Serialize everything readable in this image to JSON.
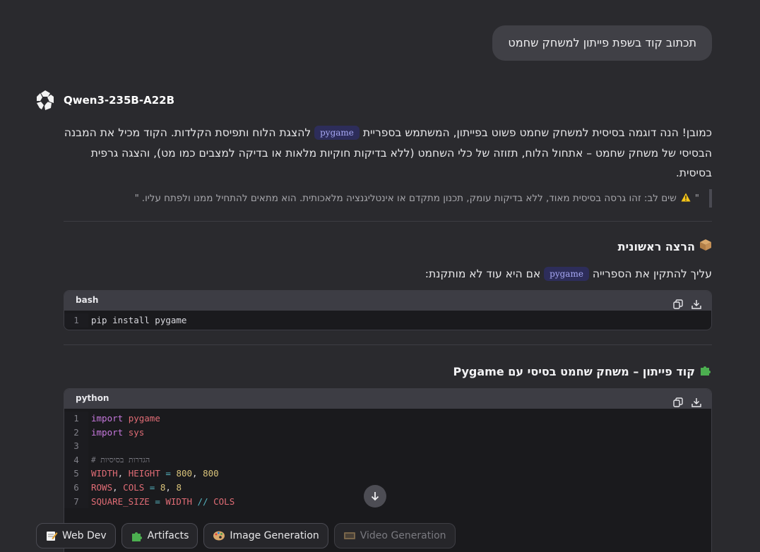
{
  "user_message": "תכתוב קוד בשפת פייתון למשחק שחמט",
  "model": {
    "name": "Qwen3-235B-A22B"
  },
  "response": {
    "intro_part1": "כמובן! הנה דוגמה בסיסית למשחק שחמט פשוט בפייתון, המשתמש בספריית",
    "intro_pill": "pygame",
    "intro_part2": "להצגת הלוח ותפיסת הקלדות. הקוד מכיל את המבנה הבסיסי של משחק שחמט – אתחול הלוח, תזוזה של כלי השחמט (ללא בדיקות חוקיות מלאות או בדיקה למצבים כמו מט), והצגה גרפית בסיסית.",
    "note": "שים לב: זהו גרסה בסיסית מאוד, ללא בדיקות עומק, תכנון מתקדם או אינטליגנציה מלאכותית. הוא מתאים להתחיל ממנו ולפתח עליו.",
    "note_open_quote": "\"",
    "note_close_quote": "\"",
    "section1_title": "הרצה ראשונית",
    "section1_para_part1": "עליך להתקין את הספרייה",
    "section1_pill": "pygame",
    "section1_para_part2": "אם היא עוד לא מותקנת:",
    "bash_block": {
      "lang": "bash",
      "lines": [
        {
          "n": "1",
          "code": "pip install pygame"
        }
      ]
    },
    "section2_title": "קוד פייתון – משחק שחמט בסיסי עם Pygame",
    "python_block": {
      "lang": "python",
      "line_numbers": [
        "1",
        "2",
        "3",
        "4",
        "5",
        "6",
        "7"
      ],
      "l1_kw": "import",
      "l1_mod": "pygame",
      "l2_kw": "import",
      "l2_mod": "sys",
      "l4_cmt": "# הגדרות בסיסיות",
      "l5_a": "WIDTH",
      "l5_b": ", ",
      "l5_c": "HEIGHT",
      "l5_eq": " = ",
      "l5_n1": "800",
      "l5_comma": ", ",
      "l5_n2": "800",
      "l6_a": "ROWS",
      "l6_b": ", ",
      "l6_c": "COLS",
      "l6_eq": " = ",
      "l6_n1": "8",
      "l6_comma": ", ",
      "l6_n2": "8",
      "l7_a": "SQUARE_SIZE",
      "l7_eq": " = ",
      "l7_b": "WIDTH",
      "l7_op": " // ",
      "l7_c": "COLS"
    }
  },
  "chips": [
    {
      "label": "Web Dev",
      "icon": "memo-icon",
      "disabled": false
    },
    {
      "label": "Artifacts",
      "icon": "puzzle-icon",
      "disabled": false
    },
    {
      "label": "Image Generation",
      "icon": "palette-icon",
      "disabled": false
    },
    {
      "label": "Video Generation",
      "icon": "film-icon",
      "disabled": true
    }
  ],
  "colors": {
    "pill_bg": "#2d2d5a",
    "pill_text": "#a7a8f5",
    "keyword": "#c678dd",
    "number": "#d9c37a"
  }
}
